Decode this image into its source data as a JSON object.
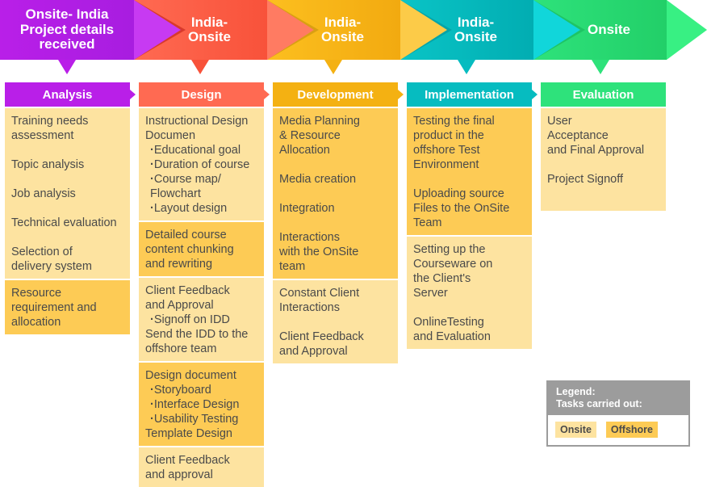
{
  "colors": {
    "stage0": "#b91fe8",
    "stage1": "#ff6a52",
    "stage2": "#f4b112",
    "stage3": "#06bcc0",
    "stage4": "#2ee27b",
    "onsite_fill": "#fde3a0",
    "offshore_fill": "#fdcb55",
    "legend_gray": "#9c9c9c"
  },
  "banner": [
    {
      "lines": [
        "Onsite- India",
        "Project details",
        "received"
      ]
    },
    {
      "lines": [
        "India-",
        "Onsite"
      ]
    },
    {
      "lines": [
        "India-",
        "Onsite"
      ]
    },
    {
      "lines": [
        "India-",
        "Onsite"
      ]
    },
    {
      "lines": [
        "Onsite"
      ]
    }
  ],
  "columns": [
    {
      "title": "Analysis",
      "blocks": [
        {
          "type": "Onsite",
          "items": [
            [
              "Training needs",
              "assessment"
            ],
            [
              "Topic analysis"
            ],
            [
              "Job analysis"
            ],
            [
              "Technical evaluation"
            ],
            [
              "Selection of",
              "delivery system"
            ]
          ]
        },
        {
          "type": "Offshore",
          "items": [
            [
              "Resource",
              "requirement and",
              "allocation"
            ]
          ]
        }
      ]
    },
    {
      "title": "Design",
      "blocks": [
        {
          "type": "Onsite",
          "lines": [
            "Instructional Design",
            "Documen"
          ],
          "subs": [
            "Educational goal",
            "Duration of course",
            "Course map/ Flowchart",
            "Layout design"
          ]
        },
        {
          "type": "Offshore",
          "lines": [
            "Detailed course",
            "content chunking",
            "and rewriting"
          ]
        },
        {
          "type": "Onsite",
          "lines": [
            "Client Feedback",
            "and Approval"
          ],
          "subs": [
            "Signoff on IDD"
          ],
          "after": [
            "Send the IDD to the",
            "offshore team"
          ]
        },
        {
          "type": "Offshore",
          "lines": [
            "Design document"
          ],
          "subs": [
            "Storyboard",
            "Interface Design",
            "Usability Testing"
          ],
          "after": [
            "Template Design"
          ]
        },
        {
          "type": "Onsite",
          "lines": [
            "Client Feedback",
            "and approval"
          ]
        }
      ]
    },
    {
      "title": "Development",
      "blocks": [
        {
          "type": "Offshore",
          "items": [
            [
              "Media Planning",
              "& Resource",
              "Allocation"
            ],
            [
              "Media creation"
            ],
            [
              "Integration"
            ],
            [
              "Interactions",
              "with the OnSite",
              "team"
            ]
          ]
        },
        {
          "type": "Onsite",
          "items": [
            [
              "Constant Client",
              "Interactions"
            ],
            [
              "Client Feedback",
              "and Approval"
            ]
          ]
        }
      ]
    },
    {
      "title": "Implementation",
      "blocks": [
        {
          "type": "Offshore",
          "items": [
            [
              "Testing the final",
              "product in the",
              "offshore Test",
              "Environment"
            ],
            [
              "Uploading source",
              "Files to the OnSite",
              "Team"
            ]
          ]
        },
        {
          "type": "Onsite",
          "items": [
            [
              "Setting up the",
              "Courseware on",
              "the Client's",
              "Server"
            ],
            [
              "OnlineTesting",
              "and Evaluation"
            ]
          ]
        }
      ]
    },
    {
      "title": "Evaluation",
      "blocks": [
        {
          "type": "Onsite",
          "items": [
            [
              "User",
              "Acceptance",
              "and Final Approval"
            ],
            [
              "Project Signoff"
            ]
          ]
        }
      ]
    }
  ],
  "legend": {
    "title": "Legend:",
    "subtitle": "Tasks carried out:",
    "onsite_label": "Onsite",
    "offshore_label": "Offshore"
  }
}
